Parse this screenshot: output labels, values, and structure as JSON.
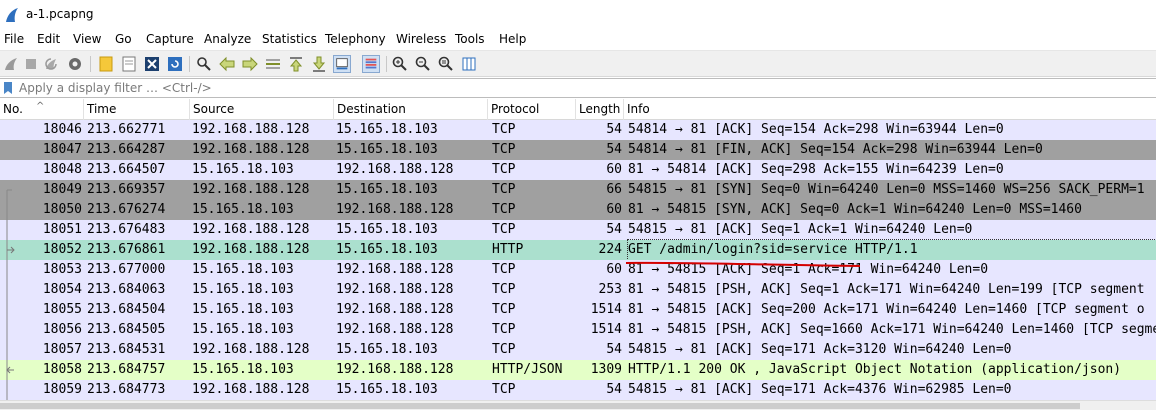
{
  "window": {
    "title": "a-1.pcapng",
    "accent_color": "#2e6fbe"
  },
  "menu": [
    "File",
    "Edit",
    "View",
    "Go",
    "Capture",
    "Analyze",
    "Statistics",
    "Telephony",
    "Wireless",
    "Tools",
    "Help"
  ],
  "toolbar": {
    "icons": [
      "start-capture-icon",
      "stop-capture-icon",
      "restart-capture-icon",
      "capture-options-icon",
      "open-file-icon",
      "save-file-icon",
      "close-file-icon",
      "reload-file-icon",
      "find-packet-icon",
      "go-back-icon",
      "go-forward-icon",
      "go-to-packet-icon",
      "go-first-icon",
      "go-last-icon",
      "auto-scroll-icon",
      "colorize-icon",
      "zoom-in-icon",
      "zoom-out-icon",
      "normal-size-icon",
      "resize-columns-icon"
    ]
  },
  "filter": {
    "placeholder": "Apply a display filter … <Ctrl-/>",
    "value": ""
  },
  "columns": [
    "No.",
    "Time",
    "Source",
    "Destination",
    "Protocol",
    "Length",
    "Info"
  ],
  "packets": [
    {
      "no": "18046",
      "time": "213.662771",
      "src": "192.168.188.128",
      "dst": "15.165.18.103",
      "proto": "TCP",
      "len": "54",
      "info": "54814 → 81 [ACK] Seq=154 Ack=298 Win=63944 Len=0",
      "style": "tcp"
    },
    {
      "no": "18047",
      "time": "213.664287",
      "src": "192.168.188.128",
      "dst": "15.165.18.103",
      "proto": "TCP",
      "len": "54",
      "info": "54814 → 81 [FIN, ACK] Seq=154 Ack=298 Win=63944 Len=0",
      "style": "fin"
    },
    {
      "no": "18048",
      "time": "213.664507",
      "src": "15.165.18.103",
      "dst": "192.168.188.128",
      "proto": "TCP",
      "len": "60",
      "info": "81 → 54814 [ACK] Seq=298 Ack=155 Win=64239 Len=0",
      "style": "tcp"
    },
    {
      "no": "18049",
      "time": "213.669357",
      "src": "192.168.188.128",
      "dst": "15.165.18.103",
      "proto": "TCP",
      "len": "66",
      "info": "54815 → 81 [SYN] Seq=0 Win=64240 Len=0 MSS=1460 WS=256 SACK_PERM=1",
      "style": "syn"
    },
    {
      "no": "18050",
      "time": "213.676274",
      "src": "15.165.18.103",
      "dst": "192.168.188.128",
      "proto": "TCP",
      "len": "60",
      "info": "81 → 54815 [SYN, ACK] Seq=0 Ack=1 Win=64240 Len=0 MSS=1460",
      "style": "syn"
    },
    {
      "no": "18051",
      "time": "213.676483",
      "src": "192.168.188.128",
      "dst": "15.165.18.103",
      "proto": "TCP",
      "len": "54",
      "info": "54815 → 81 [ACK] Seq=1 Ack=1 Win=64240 Len=0",
      "style": "tcp"
    },
    {
      "no": "18052",
      "time": "213.676861",
      "src": "192.168.188.128",
      "dst": "15.165.18.103",
      "proto": "HTTP",
      "len": "224",
      "info": "GET /admin/login?sid=service HTTP/1.1",
      "style": "sel"
    },
    {
      "no": "18053",
      "time": "213.677000",
      "src": "15.165.18.103",
      "dst": "192.168.188.128",
      "proto": "TCP",
      "len": "60",
      "info": "81 → 54815 [ACK] Seq=1 Ack=171 Win=64240 Len=0",
      "style": "tcp"
    },
    {
      "no": "18054",
      "time": "213.684063",
      "src": "15.165.18.103",
      "dst": "192.168.188.128",
      "proto": "TCP",
      "len": "253",
      "info": "81 → 54815 [PSH, ACK] Seq=1 Ack=171 Win=64240 Len=199 [TCP segment",
      "style": "tcp"
    },
    {
      "no": "18055",
      "time": "213.684504",
      "src": "15.165.18.103",
      "dst": "192.168.188.128",
      "proto": "TCP",
      "len": "1514",
      "info": "81 → 54815 [ACK] Seq=200 Ack=171 Win=64240 Len=1460 [TCP segment o",
      "style": "tcp"
    },
    {
      "no": "18056",
      "time": "213.684505",
      "src": "15.165.18.103",
      "dst": "192.168.188.128",
      "proto": "TCP",
      "len": "1514",
      "info": "81 → 54815 [PSH, ACK] Seq=1660 Ack=171 Win=64240 Len=1460 [TCP segme",
      "style": "tcp"
    },
    {
      "no": "18057",
      "time": "213.684531",
      "src": "192.168.188.128",
      "dst": "15.165.18.103",
      "proto": "TCP",
      "len": "54",
      "info": "54815 → 81 [ACK] Seq=171 Ack=3120 Win=64240 Len=0",
      "style": "tcp"
    },
    {
      "no": "18058",
      "time": "213.684757",
      "src": "15.165.18.103",
      "dst": "192.168.188.128",
      "proto": "HTTP/JSON",
      "len": "1309",
      "info": "HTTP/1.1 200 OK , JavaScript Object Notation (application/json)",
      "style": "http"
    },
    {
      "no": "18059",
      "time": "213.684773",
      "src": "192.168.188.128",
      "dst": "15.165.18.103",
      "proto": "TCP",
      "len": "54",
      "info": "54815 → 81 [ACK] Seq=171 Ack=4376 Win=62985 Len=0",
      "style": "tcp"
    }
  ],
  "annotation": {
    "underline_color": "#d40000"
  }
}
